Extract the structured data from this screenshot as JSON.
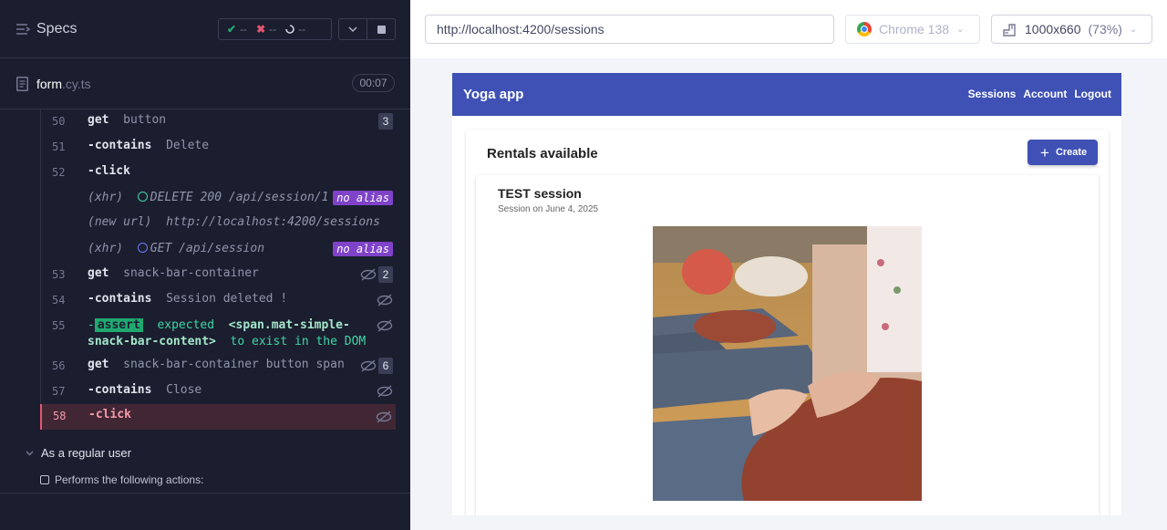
{
  "reporter": {
    "specs_title": "Specs",
    "stats": {
      "passed": "--",
      "failed": "--",
      "pending": "--"
    },
    "file": {
      "name": "form",
      "ext": ".cy.ts",
      "duration": "00:07"
    },
    "commands": [
      {
        "num": "50",
        "name": "get",
        "message": "button",
        "count": "3"
      },
      {
        "num": "51",
        "name": "-contains",
        "message": "Delete"
      },
      {
        "num": "52",
        "name": "-click",
        "message": ""
      },
      {
        "num": "53",
        "name": "get",
        "message": "snack-bar-container",
        "count": "2"
      },
      {
        "num": "54",
        "name": "-contains",
        "message": "Session deleted !"
      },
      {
        "num": "55",
        "name": "-",
        "assert_label": "assert",
        "message_pre": "expected",
        "message_el": "<span.mat-simple-snack-bar-content>",
        "message_post": "to exist in the DOM"
      },
      {
        "num": "56",
        "name": "get",
        "message": "snack-bar-container button span",
        "count": "6"
      },
      {
        "num": "57",
        "name": "-contains",
        "message": "Close"
      },
      {
        "num": "58",
        "name": "-click",
        "message": ""
      }
    ],
    "events": [
      {
        "type": "(xhr)",
        "text": "DELETE 200 /api/session/1",
        "alias": "no alias",
        "color": "#3ed6a5"
      },
      {
        "type": "(new url)",
        "text": "http://localhost:4200/sessions"
      },
      {
        "type": "(xhr)",
        "text": "GET /api/session",
        "alias": "no alias",
        "color": "#6c7bff"
      }
    ],
    "suite": "As a regular user",
    "test": "Performs the following actions:"
  },
  "aut": {
    "url": "http://localhost:4200/sessions",
    "browser": "Chrome 138",
    "viewport": "1000x660",
    "zoom": "(73%)",
    "app": {
      "title": "Yoga app",
      "nav": [
        "Sessions",
        "Account",
        "Logout"
      ],
      "heading": "Rentals available",
      "create_label": "Create",
      "session": {
        "title": "TEST session",
        "date": "Session on June 4, 2025"
      }
    }
  },
  "colors": {
    "accent": "#3f51b5",
    "reporter_bg": "#1b1e2e",
    "active_row": "#412734"
  }
}
